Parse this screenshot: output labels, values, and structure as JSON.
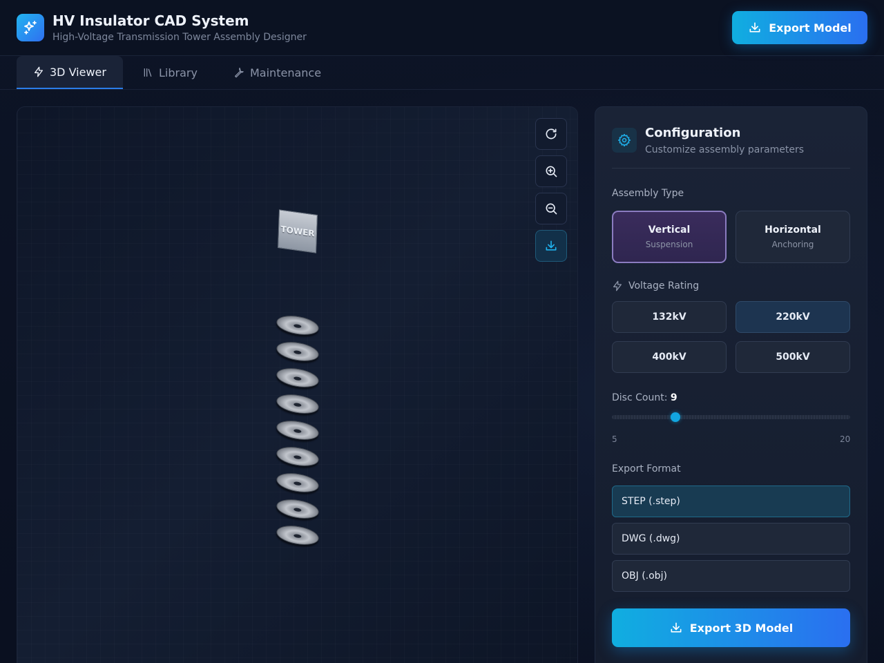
{
  "app": {
    "title": "HV Insulator CAD System",
    "subtitle": "High-Voltage Transmission Tower Assembly Designer",
    "export_button": "Export Model"
  },
  "tabs": [
    {
      "label": "3D Viewer",
      "icon": "lightning-icon",
      "active": true
    },
    {
      "label": "Library",
      "icon": "library-icon",
      "active": false
    },
    {
      "label": "Maintenance",
      "icon": "wrench-icon",
      "active": false
    }
  ],
  "viewer": {
    "tower_label": "TOWER",
    "disc_count": 9,
    "tools": [
      "reset-view-icon",
      "zoom-in-icon",
      "zoom-out-icon",
      "download-icon"
    ]
  },
  "config": {
    "title": "Configuration",
    "subtitle": "Customize assembly parameters",
    "assembly_type_label": "Assembly Type",
    "assembly_types": [
      {
        "main": "Vertical",
        "sub": "Suspension",
        "selected": true
      },
      {
        "main": "Horizontal",
        "sub": "Anchoring",
        "selected": false
      }
    ],
    "voltage_label": "Voltage Rating",
    "voltages": [
      {
        "label": "132kV",
        "selected": false
      },
      {
        "label": "220kV",
        "selected": true
      },
      {
        "label": "400kV",
        "selected": false
      },
      {
        "label": "500kV",
        "selected": false
      }
    ],
    "disc_count_label": "Disc Count:",
    "disc_count_value": "9",
    "slider": {
      "min": "5",
      "max": "20",
      "value": 9
    },
    "export_format_label": "Export Format",
    "formats": [
      {
        "label": "STEP (.step)",
        "selected": true
      },
      {
        "label": "DWG (.dwg)",
        "selected": false
      },
      {
        "label": "OBJ (.obj)",
        "selected": false
      }
    ],
    "export_button": "Export 3D Model"
  },
  "colors": {
    "accent": "#12a6e0",
    "accent_gradient_end": "#2a6ff0",
    "background": "#0b1122",
    "panel": "#1a2336",
    "selected_type": "#3a2c5c"
  }
}
